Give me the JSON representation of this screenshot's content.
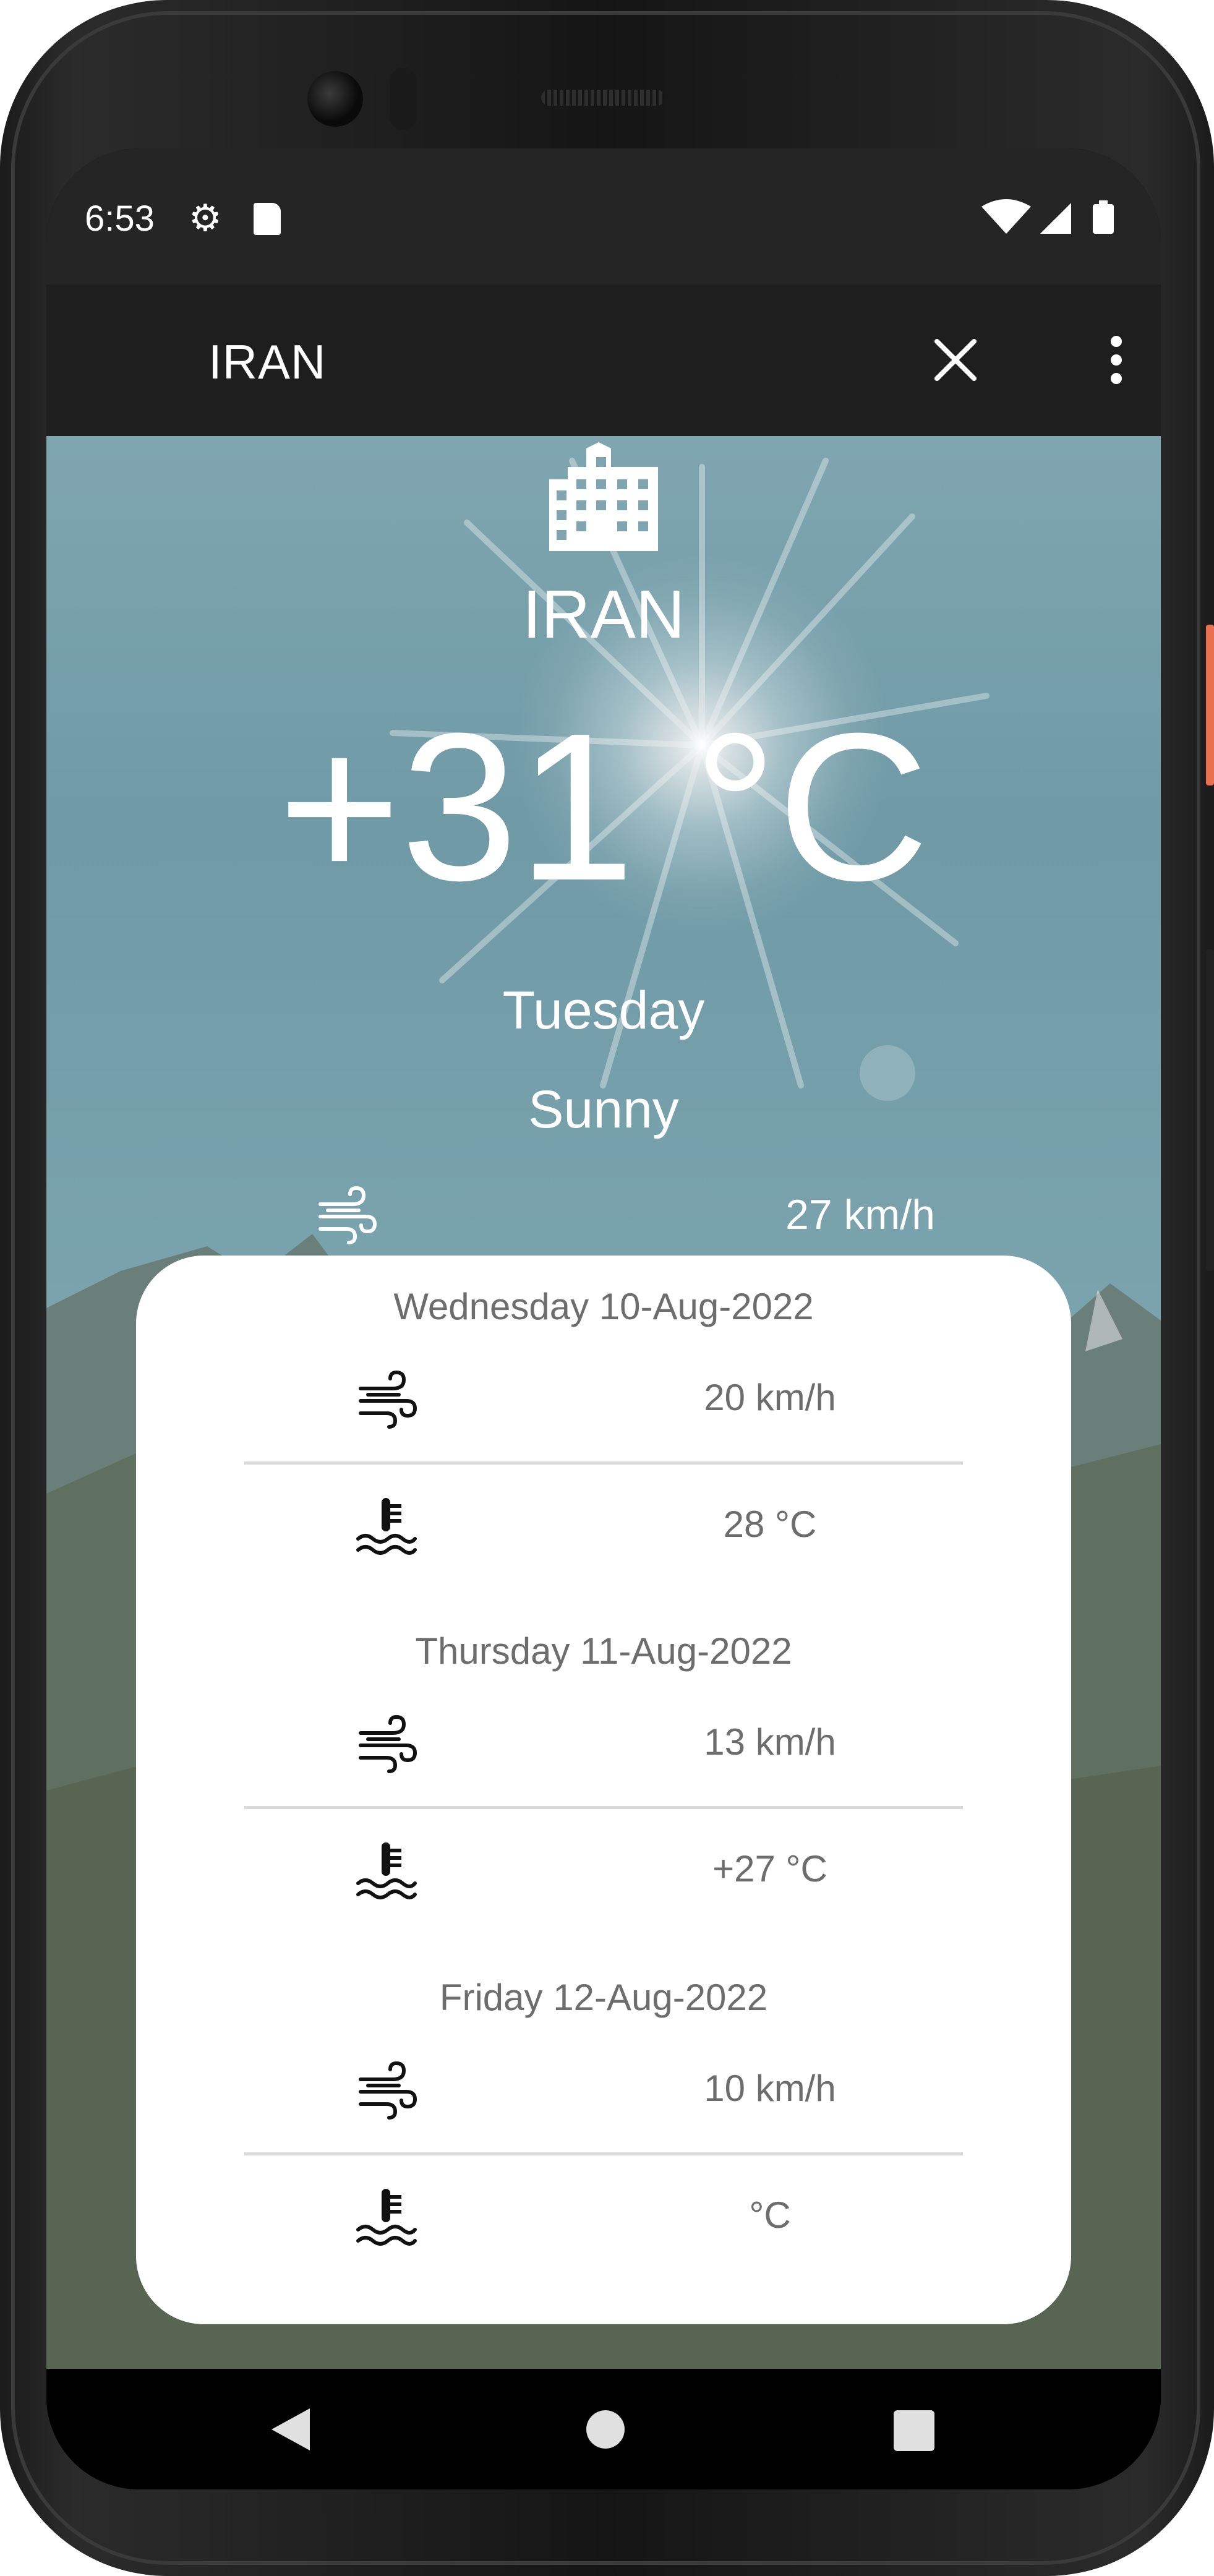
{
  "status_bar": {
    "time": "6:53"
  },
  "app_bar": {
    "title": "IRAN",
    "close_label": "close",
    "more_label": "more"
  },
  "current": {
    "country": "IRAN",
    "temperature": "+31 °C",
    "day": "Tuesday",
    "condition": "Sunny",
    "wind": "27 km/h"
  },
  "forecast": [
    {
      "date": "Wednesday 10-Aug-2022",
      "wind": "20 km/h",
      "temperature": "28 °C"
    },
    {
      "date": "Thursday 11-Aug-2022",
      "wind": "13 km/h",
      "temperature": "+27 °C"
    },
    {
      "date": "Friday 12-Aug-2022",
      "wind": "10 km/h",
      "temperature": "°C"
    }
  ],
  "icons": {
    "city": "city-buildings-icon",
    "wind": "wind-icon",
    "temperature": "water-thermometer-icon"
  },
  "colors": {
    "app_bar": "#1e1e1e",
    "status_bar": "#252525",
    "card": "#ffffff",
    "muted_text": "#6d6d6d"
  }
}
